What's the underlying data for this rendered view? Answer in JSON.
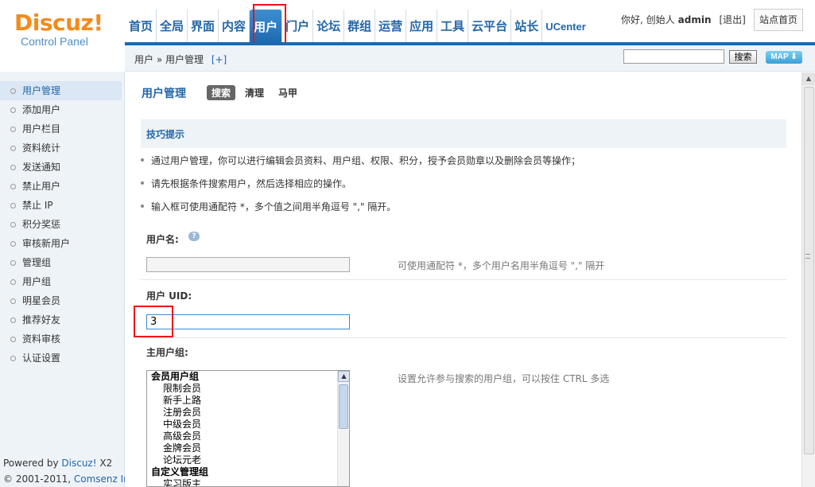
{
  "logo": {
    "main": "Discuz!",
    "sub": "Control Panel"
  },
  "nav": {
    "items": [
      "首页",
      "全局",
      "界面",
      "内容",
      "用户",
      "门户",
      "论坛",
      "群组",
      "运营",
      "应用",
      "工具",
      "云平台",
      "站长",
      "UCenter"
    ],
    "active": "用户"
  },
  "user": {
    "greeting": "你好, 创始人",
    "name": "admin",
    "logout": "[退出]",
    "site_home": "站点首页"
  },
  "breadcrumb": {
    "path": "用户 » 用户管理",
    "add": "[+]"
  },
  "search": {
    "button": "搜索",
    "map": "MAP"
  },
  "sidebar": {
    "items": [
      "用户管理",
      "添加用户",
      "用户栏目",
      "资料统计",
      "发送通知",
      "禁止用户",
      "禁止 IP",
      "积分奖惩",
      "审核新用户",
      "管理组",
      "用户组",
      "明星会员",
      "推荐好友",
      "资料审核",
      "认证设置"
    ],
    "footer_powered": "Powered by",
    "footer_brand": "Discuz!",
    "footer_version": "X2",
    "footer_copy": "© 2001-2011,",
    "footer_company": "Comsenz Inc."
  },
  "main": {
    "title": "用户管理",
    "tabs": [
      "搜索",
      "清理",
      "马甲"
    ],
    "tips_title": "技巧提示",
    "tips": [
      "通过用户管理，你可以进行编辑会员资料、用户组、权限、积分，授予会员勋章以及删除会员等操作；",
      "请先根据条件搜索用户，然后选择相应的操作。",
      "输入框可使用通配符 *，多个值之间用半角逗号 \",\" 隔开。"
    ],
    "username_label": "用户名:",
    "username_value": "",
    "username_hint": "可使用通配符 *，多个用户名用半角逗号 \",\" 隔开",
    "uid_label": "用户 UID:",
    "uid_value": "3",
    "group_label": "主用户组:",
    "group_hint": "设置允许参与搜索的用户组，可以按住 CTRL 多选",
    "groups": [
      {
        "label": "会员用户组",
        "type": "head"
      },
      {
        "label": "限制会员",
        "type": "child"
      },
      {
        "label": "新手上路",
        "type": "child"
      },
      {
        "label": "注册会员",
        "type": "child"
      },
      {
        "label": "中级会员",
        "type": "child"
      },
      {
        "label": "高级会员",
        "type": "child"
      },
      {
        "label": "金牌会员",
        "type": "child"
      },
      {
        "label": "论坛元老",
        "type": "child"
      },
      {
        "label": "自定义管理组",
        "type": "head"
      },
      {
        "label": "实习版主",
        "type": "child"
      }
    ]
  },
  "colors": {
    "accent": "#2366a8",
    "logo": "#f28b1c",
    "highlight": "#ee1111"
  }
}
